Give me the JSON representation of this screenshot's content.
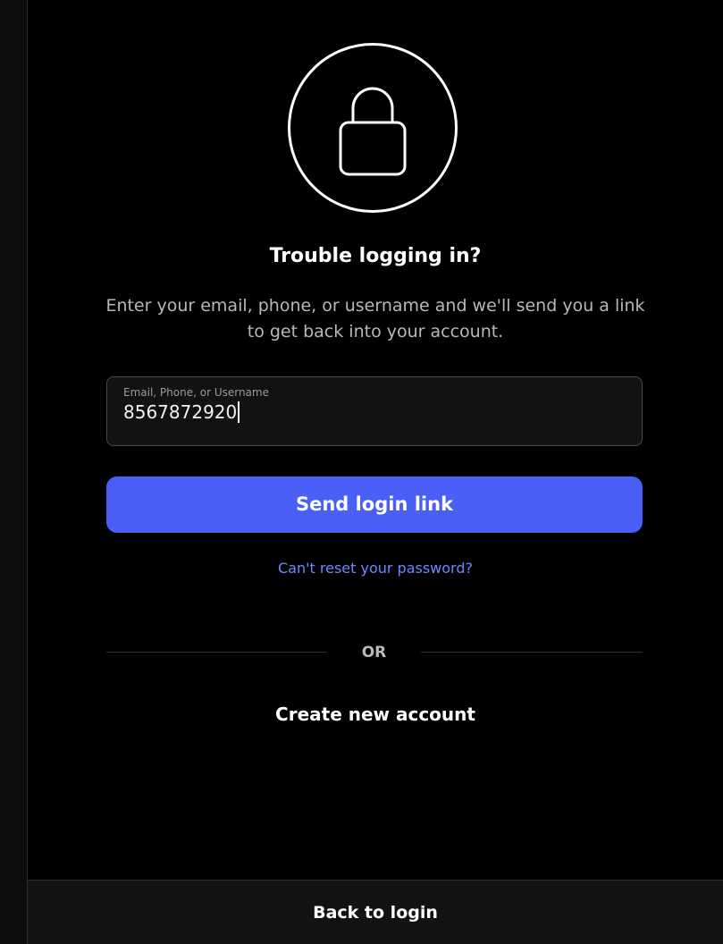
{
  "icons": {
    "lock": "lock-icon"
  },
  "header": {
    "title": "Trouble logging in?",
    "description": "Enter your email, phone, or username and we'll send you a link to get back into your account."
  },
  "form": {
    "input_label": "Email, Phone, or Username",
    "input_value": "8567872920",
    "send_button_label": "Send login link"
  },
  "links": {
    "reset_password": "Can't reset your password?",
    "or_label": "OR",
    "create_account": "Create new account",
    "back_to_login": "Back to login"
  },
  "colors": {
    "background": "#000000",
    "accent": "#4a5ff5",
    "link": "#6d89ff"
  }
}
